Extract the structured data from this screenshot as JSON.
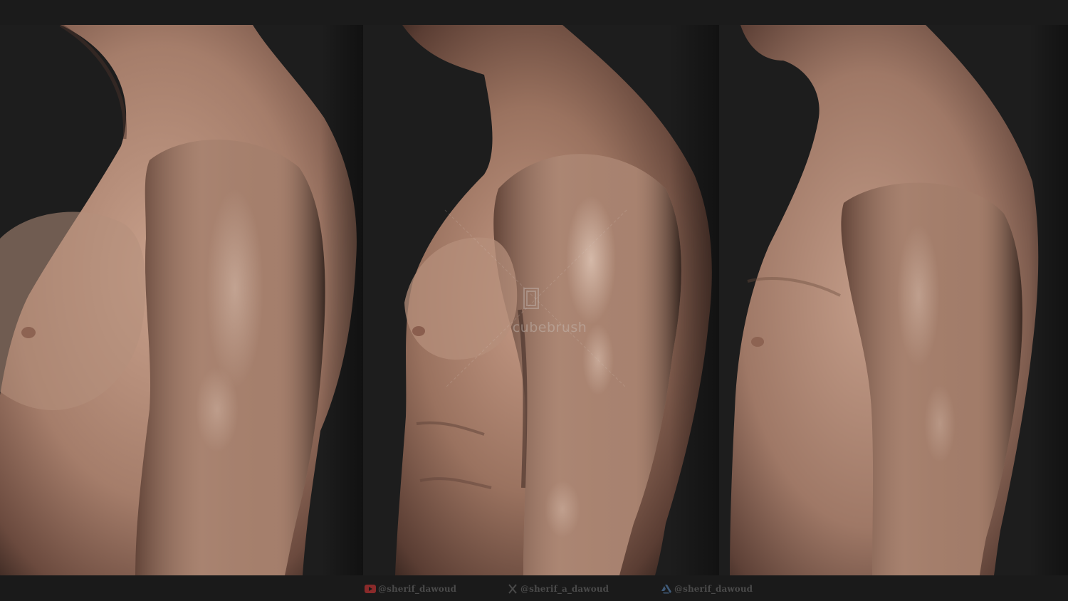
{
  "watermark": {
    "text": "cubebrush"
  },
  "footer": {
    "youtube_handle": "@sherif_dawoud",
    "x_handle": "@sherif_a_dawoud",
    "artstation_handle": "@sherif_dawoud",
    "icons": [
      "youtube-icon",
      "x-icon",
      "artstation-icon"
    ]
  },
  "colors": {
    "background": "#1d1d1d",
    "skin_light": "#c39b86",
    "skin_mid": "#8f6a5a",
    "skin_dark": "#3a2620",
    "youtube_red": "#8a2a2a"
  }
}
